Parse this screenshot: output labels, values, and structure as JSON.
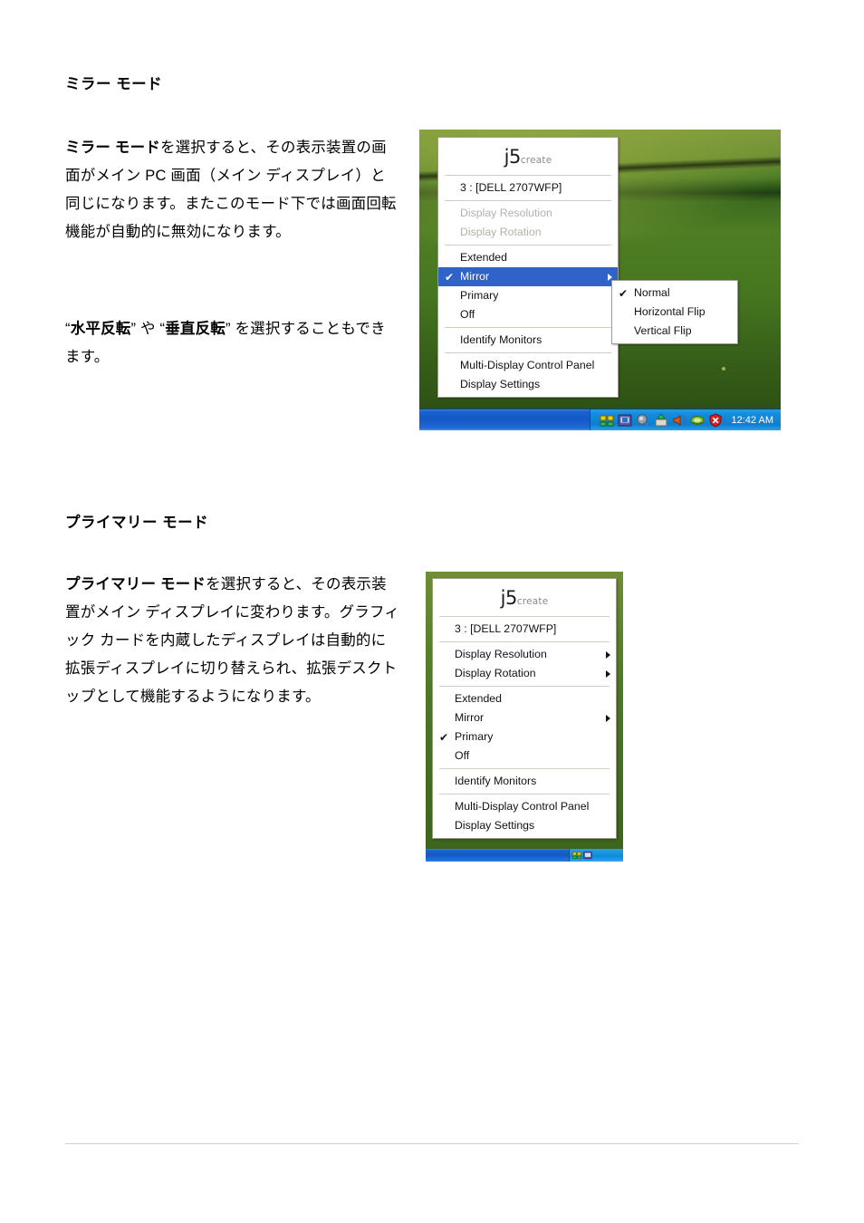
{
  "document": {
    "sections": [
      {
        "heading": "ミラー モード",
        "paragraphs": [
          {
            "bold_lead": "ミラー モード",
            "rest": "を選択すると、その表示装置の画面がメイン PC 画面（メイン ディスプレイ）と同じになります。またこのモード下では画面回転機能が自動的に無効になります。"
          },
          {
            "part1": "“",
            "bold1": "水平反転",
            "part2": "” や “",
            "bold2": "垂直反転",
            "part3": "” を選択することもできます。"
          }
        ]
      },
      {
        "heading": "プライマリー モード",
        "paragraphs": [
          {
            "bold_lead": "プライマリー モード",
            "rest": "を選択すると、その表示装置がメイン ディスプレイに変わります。グラフィック カードを内蔵したディスプレイは自動的に拡張ディスプレイに切り替えられ、拡張デスクトップとして機能するようになります。"
          }
        ]
      }
    ]
  },
  "brand": {
    "logo_mark": "j5",
    "logo_word": "create",
    "accent_color": "#8a8a8a"
  },
  "screenshot_mirror": {
    "caption_mode": "Mirror",
    "desktop_background_color": "#46761f",
    "menu": {
      "device_label": "3 : [DELL 2707WFP]",
      "items": [
        {
          "label": "Display Resolution",
          "disabled": true,
          "checked": false,
          "submenu": false
        },
        {
          "label": "Display Rotation",
          "disabled": true,
          "checked": false,
          "submenu": false
        },
        {
          "label": "Extended",
          "disabled": false,
          "checked": false,
          "submenu": false
        },
        {
          "label": "Mirror",
          "disabled": false,
          "checked": true,
          "submenu": true,
          "highlighted": true
        },
        {
          "label": "Primary",
          "disabled": false,
          "checked": false,
          "submenu": false
        },
        {
          "label": "Off",
          "disabled": false,
          "checked": false,
          "submenu": false
        },
        {
          "label": "Identify Monitors",
          "disabled": false,
          "checked": false,
          "submenu": false
        },
        {
          "label": "Multi-Display Control Panel",
          "disabled": false,
          "checked": false,
          "submenu": false
        },
        {
          "label": "Display Settings",
          "disabled": false,
          "checked": false,
          "submenu": false
        }
      ],
      "highlight_color": "#2f63c8",
      "highlight_text_color": "#ffffff"
    },
    "submenu": {
      "items": [
        {
          "label": "Normal",
          "checked": true
        },
        {
          "label": "Horizontal Flip",
          "checked": false
        },
        {
          "label": "Vertical Flip",
          "checked": false
        }
      ]
    },
    "taskbar": {
      "clock": "12:42 AM",
      "tray_icons": [
        "network-icon",
        "display-icon",
        "volume-mute-icon",
        "update-icon",
        "speaker-icon",
        "nvidia-icon",
        "security-alert-icon"
      ],
      "background_color": "#1557c4"
    }
  },
  "screenshot_primary": {
    "caption_mode": "Primary",
    "desktop_background_color": "#4f7826",
    "menu": {
      "device_label": "3 : [DELL 2707WFP]",
      "items": [
        {
          "label": "Display Resolution",
          "disabled": false,
          "checked": false,
          "submenu": true
        },
        {
          "label": "Display Rotation",
          "disabled": false,
          "checked": false,
          "submenu": true
        },
        {
          "label": "Extended",
          "disabled": false,
          "checked": false,
          "submenu": false
        },
        {
          "label": "Mirror",
          "disabled": false,
          "checked": false,
          "submenu": true
        },
        {
          "label": "Primary",
          "disabled": false,
          "checked": true,
          "submenu": false
        },
        {
          "label": "Off",
          "disabled": false,
          "checked": false,
          "submenu": false
        },
        {
          "label": "Identify Monitors",
          "disabled": false,
          "checked": false,
          "submenu": false
        },
        {
          "label": "Multi-Display Control Panel",
          "disabled": false,
          "checked": false,
          "submenu": false
        },
        {
          "label": "Display Settings",
          "disabled": false,
          "checked": false,
          "submenu": false
        }
      ]
    },
    "taskbar": {
      "background_color": "#1557c4"
    }
  },
  "glyphs": {
    "checkmark": "✔",
    "colon_space": " : "
  }
}
